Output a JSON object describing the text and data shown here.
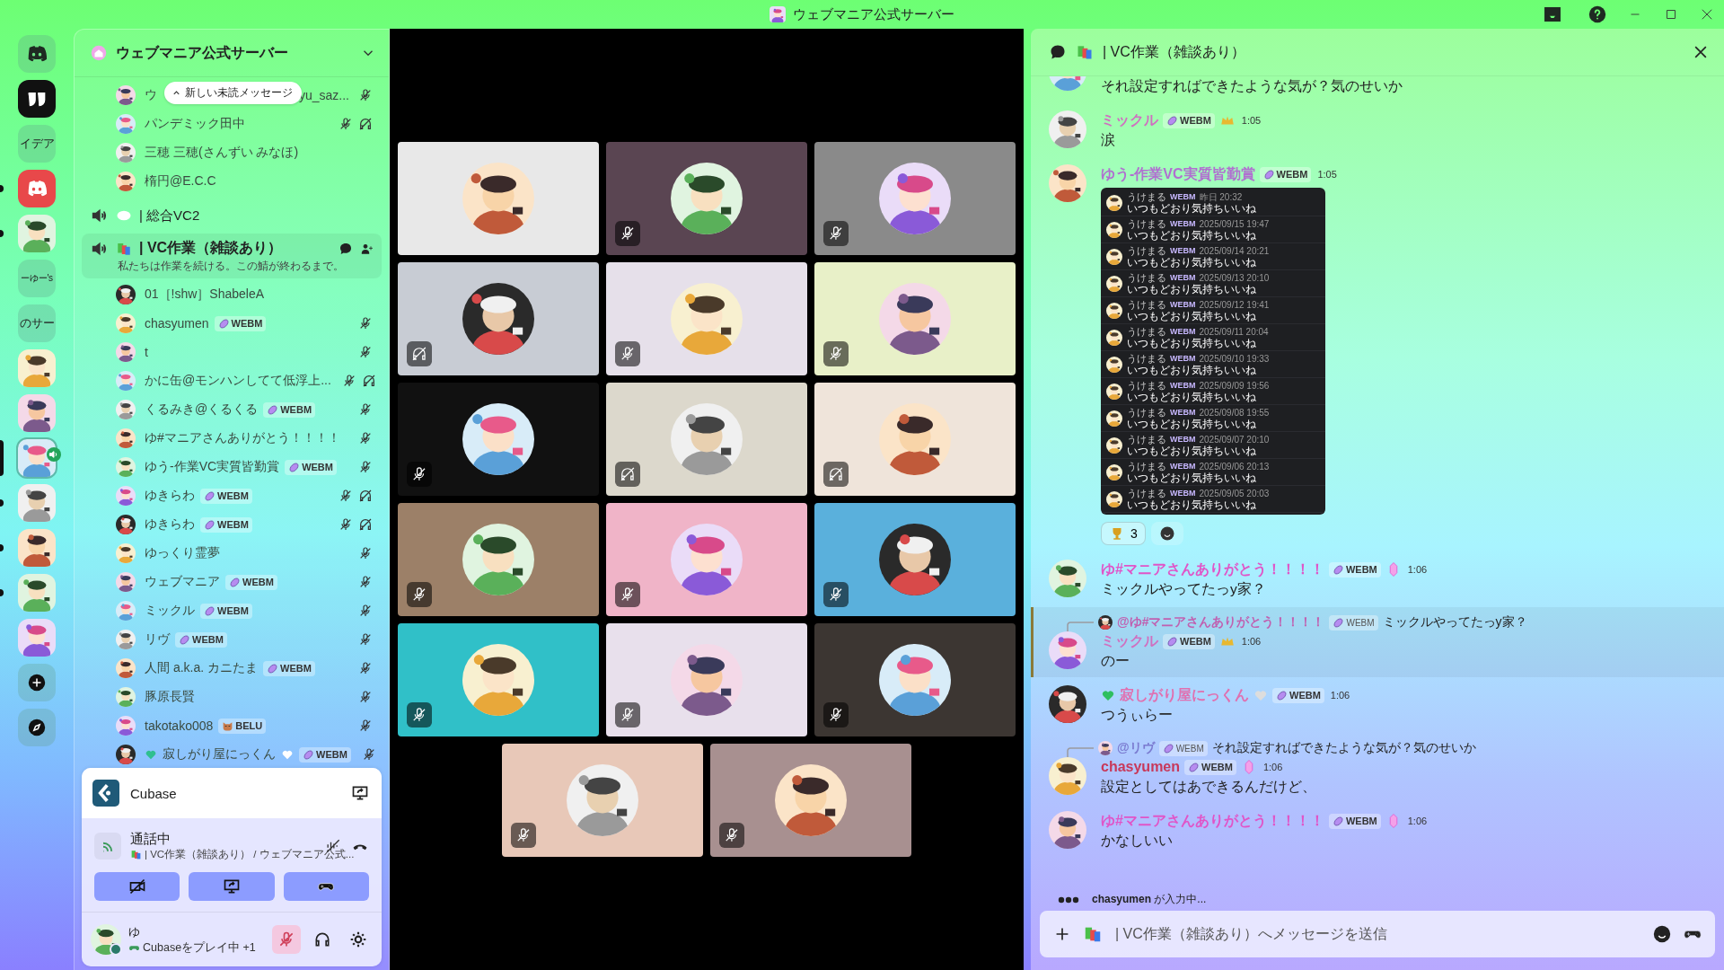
{
  "window": {
    "title": "ウェブマニア公式サーバー"
  },
  "servers": [
    {
      "kind": "home",
      "unread": false,
      "selected": false,
      "in_voice": false
    },
    {
      "kind": "quote",
      "unread": false,
      "selected": false,
      "in_voice": false
    },
    {
      "kind": "text",
      "label": "イデア",
      "unread": false,
      "selected": false,
      "in_voice": false
    },
    {
      "kind": "logo",
      "unread": true,
      "selected": false,
      "in_voice": false
    },
    {
      "kind": "picture",
      "unread": true,
      "selected": false,
      "in_voice": false
    },
    {
      "kind": "text",
      "label": "ーゆー's",
      "unread": false,
      "selected": false,
      "in_voice": false
    },
    {
      "kind": "text",
      "label": "のサー",
      "unread": false,
      "selected": false,
      "in_voice": false
    },
    {
      "kind": "picture",
      "unread": false,
      "selected": false,
      "in_voice": false
    },
    {
      "kind": "picture",
      "unread": false,
      "selected": false,
      "in_voice": false
    },
    {
      "kind": "picture",
      "unread": false,
      "selected": true,
      "in_voice": true
    },
    {
      "kind": "picture",
      "unread": true,
      "selected": false,
      "in_voice": false
    },
    {
      "kind": "picture",
      "unread": true,
      "selected": false,
      "in_voice": false
    },
    {
      "kind": "picture",
      "unread": true,
      "selected": false,
      "in_voice": false
    },
    {
      "kind": "picture",
      "unread": false,
      "selected": false,
      "in_voice": false
    },
    {
      "kind": "add",
      "unread": false,
      "selected": false,
      "in_voice": false
    },
    {
      "kind": "explore",
      "unread": false,
      "selected": false,
      "in_voice": false
    }
  ],
  "server": {
    "name": "ウェブマニア公式サーバー"
  },
  "tooltip": "新しい未読メッセージ",
  "channels": [
    {
      "members": [
        {
          "name": "ウ",
          "name_tail": "yu_saz...",
          "muted": true,
          "deafened": false,
          "hearts": false
        },
        {
          "name": "パンデミック田中",
          "muted": true,
          "deafened": true,
          "hearts": false
        },
        {
          "name": "三穂 三穂(さんずい みなほ)",
          "muted": false,
          "deafened": false,
          "hearts": false
        },
        {
          "name": "楕円@E.C.C",
          "muted": false,
          "deafened": false,
          "hearts": false
        }
      ]
    },
    {
      "name": "| 総合VC2",
      "selected": false
    },
    {
      "name": "| VC作業（雑談あり）",
      "selected": true,
      "status": "私たちは作業を続ける。この鯖が終わるまで。",
      "members": [
        {
          "name": "01［!shw］ShabeleA",
          "muted": false,
          "deafened": false,
          "hearts": false
        },
        {
          "name": "chasyumen",
          "badge": {
            "label": "WEBM",
            "kind": "leaf"
          },
          "muted": true,
          "deafened": false,
          "hearts": false
        },
        {
          "name": "t",
          "muted": true,
          "deafened": false,
          "hearts": false
        },
        {
          "name": "かに缶@モンハンしてて低浮上...",
          "muted": true,
          "deafened": true,
          "hearts": false
        },
        {
          "name": "くるみき@くるくる",
          "badge": {
            "label": "WEBM",
            "kind": "leaf"
          },
          "muted": true,
          "deafened": false,
          "hearts": false
        },
        {
          "name": "ゆ#マニアさんありがとう！！！！",
          "muted": true,
          "deafened": false,
          "hearts": false
        },
        {
          "name": "ゆう-作業VC実質皆勤賞",
          "badge": {
            "label": "WEBM",
            "kind": "leaf"
          },
          "muted": true,
          "deafened": false,
          "hearts": false
        },
        {
          "name": "ゆきらわ",
          "badge": {
            "label": "WEBM",
            "kind": "leaf"
          },
          "muted": true,
          "deafened": true,
          "hearts": false
        },
        {
          "name": "ゆきらわ",
          "badge": {
            "label": "WEBM",
            "kind": "leaf"
          },
          "muted": true,
          "deafened": true,
          "hearts": false
        },
        {
          "name": "ゆっくり霊夢",
          "muted": true,
          "deafened": false,
          "hearts": false
        },
        {
          "name": "ウェブマニア",
          "badge": {
            "label": "WEBM",
            "kind": "leaf"
          },
          "muted": true,
          "deafened": false,
          "hearts": false
        },
        {
          "name": "ミックル",
          "badge": {
            "label": "WEBM",
            "kind": "leaf"
          },
          "muted": true,
          "deafened": false,
          "hearts": false
        },
        {
          "name": "リヴ",
          "badge": {
            "label": "WEBM",
            "kind": "leaf"
          },
          "muted": true,
          "deafened": false,
          "hearts": false
        },
        {
          "name": "人間 a.k.a. カニたま",
          "badge": {
            "label": "WEBM",
            "kind": "leaf"
          },
          "muted": true,
          "deafened": false,
          "hearts": false
        },
        {
          "name": "豚原長賢",
          "muted": true,
          "deafened": false,
          "hearts": false
        },
        {
          "name": "takotako008",
          "badge": {
            "label": "BELU",
            "kind": "cat"
          },
          "muted": true,
          "deafened": false,
          "hearts": false
        },
        {
          "name": "寂しがり屋にっくん",
          "badge": {
            "label": "WEBM",
            "kind": "leaf"
          },
          "muted": true,
          "deafened": false,
          "hearts": true
        }
      ]
    }
  ],
  "voice_panel": {
    "activity": "Cubase",
    "status": "通話中",
    "location": "| VC作業（雑談あり） / ウェブマニア公式...",
    "buttons": [
      {
        "kind": "camera"
      },
      {
        "kind": "share"
      },
      {
        "kind": "activity"
      }
    ],
    "user": {
      "name": "ゆ",
      "activity": "Cubaseをプレイ中 +1",
      "mic_muted": true,
      "deafened": false
    }
  },
  "tiles": [
    {
      "color": "#e8e8e8",
      "muted": false,
      "deafened": false
    },
    {
      "color": "#5a4552",
      "muted": true,
      "deafened": false
    },
    {
      "color": "#8a8a8a",
      "muted": true,
      "deafened": false
    },
    {
      "color": "#c8ccd4",
      "muted": false,
      "deafened": true
    },
    {
      "color": "#e6e0ea",
      "muted": true,
      "deafened": false
    },
    {
      "color": "#e8f0c8",
      "muted": true,
      "deafened": false
    },
    {
      "color": "#111111",
      "muted": true,
      "deafened": false
    },
    {
      "color": "#dcd8cc",
      "muted": false,
      "deafened": true
    },
    {
      "color": "#efe4da",
      "muted": false,
      "deafened": true
    },
    {
      "color": "#9c8068",
      "muted": true,
      "deafened": false
    },
    {
      "color": "#f0b4c8",
      "muted": true,
      "deafened": false
    },
    {
      "color": "#5ab0dc",
      "muted": true,
      "deafened": false
    },
    {
      "color": "#30c0c8",
      "muted": true,
      "deafened": false
    },
    {
      "color": "#e8e0ec",
      "muted": true,
      "deafened": false
    },
    {
      "color": "#3c3632",
      "muted": true,
      "deafened": false
    },
    {
      "color": "#e8c8b8",
      "muted": true,
      "deafened": false
    },
    {
      "color": "#a89090",
      "muted": true,
      "deafened": false
    }
  ],
  "thread": {
    "title": "| VC作業（雑談あり）"
  },
  "messages": [
    {
      "text": "それ設定すればできたような気が？気のせいか",
      "highlighted": false
    },
    {
      "author": "ミックル",
      "color": "#d070c0",
      "hearts": false,
      "badge": "WEBM",
      "flair": {
        "kind": "crown"
      },
      "time": "1:05",
      "text": "涙",
      "highlighted": false
    },
    {
      "author": "ゆう-作業VC実質皆勤賞",
      "color": "#b070d0",
      "hearts": false,
      "badge": "WEBM",
      "time": "1:05",
      "highlighted": false,
      "attachment": [
        {
          "name": "うけまる",
          "badge": "WEBM",
          "date": "昨日 20:32",
          "text": "いつもどおり気持ちいいね"
        },
        {
          "name": "うけまる",
          "badge": "WEBM",
          "date": "2025/09/15 19:47",
          "text": "いつもどおり気持ちいいね"
        },
        {
          "name": "うけまる",
          "badge": "WEBM",
          "date": "2025/09/14 20:21",
          "text": "いつもどおり気持ちいいね"
        },
        {
          "name": "うけまる",
          "badge": "WEBM",
          "date": "2025/09/13 20:10",
          "text": "いつもどおり気持ちいいね"
        },
        {
          "name": "うけまる",
          "badge": "WEBM",
          "date": "2025/09/12 19:41",
          "text": "いつもどおり気持ちいいね"
        },
        {
          "name": "うけまる",
          "badge": "WEBM",
          "date": "2025/09/11 20:04",
          "text": "いつもどおり気持ちいいね"
        },
        {
          "name": "うけまる",
          "badge": "WEBM",
          "date": "2025/09/10 19:33",
          "text": "いつもどおり気持ちいいね"
        },
        {
          "name": "うけまる",
          "badge": "WEBM",
          "date": "2025/09/09 19:56",
          "text": "いつもどおり気持ちいいね"
        },
        {
          "name": "うけまる",
          "badge": "WEBM",
          "date": "2025/09/08 19:55",
          "text": "いつもどおり気持ちいいね"
        },
        {
          "name": "うけまる",
          "badge": "WEBM",
          "date": "2025/09/07 20:10",
          "text": "いつもどおり気持ちいいね"
        },
        {
          "name": "うけまる",
          "badge": "WEBM",
          "date": "2025/09/06 20:13",
          "text": "いつもどおり気持ちいいね"
        },
        {
          "name": "うけまる",
          "badge": "WEBM",
          "date": "2025/09/05 20:03",
          "text": "いつもどおり気持ちいいね"
        }
      ],
      "reactions": [
        {
          "count": "3"
        }
      ]
    },
    {
      "author": "ゆ#マニアさんありがとう！！！！",
      "color": "#e055c8",
      "hearts": false,
      "badge": "WEBM",
      "flair": {
        "kind": "gem"
      },
      "time": "1:06",
      "text": "ミックルやってたっy家？",
      "highlighted": false
    },
    {
      "reply": {
        "author": "@ゆ#マニアさんありがとう！！！！",
        "color": "#c060b0",
        "badge": "WEBM",
        "text": "ミックルやってたっy家？"
      },
      "author": "ミックル",
      "color": "#d070c0",
      "hearts": false,
      "badge": "WEBM",
      "flair": {
        "kind": "crown"
      },
      "time": "1:06",
      "text": "のー",
      "highlighted": true
    },
    {
      "author": "寂しがり屋にっくん",
      "color": "#e070b0",
      "hearts": true,
      "badge": "WEBM",
      "time": "1:06",
      "text": "つうぃらー",
      "highlighted": false
    },
    {
      "reply": {
        "author": "@リヴ",
        "color": "#7a7ad0",
        "badge": "WEBM",
        "text": "それ設定すればできたような気が？気のせいか"
      },
      "author": "chasyumen",
      "color": "#c8385a",
      "hearts": false,
      "badge": "WEBM",
      "flair": {
        "kind": "gem"
      },
      "time": "1:06",
      "text": "設定としてはあできるんだけど、",
      "highlighted": false
    },
    {
      "author": "ゆ#マニアさんありがとう！！！！",
      "color": "#e055c8",
      "hearts": false,
      "badge": "WEBM",
      "flair": {
        "kind": "gem"
      },
      "time": "1:06",
      "text": "かなしいい",
      "highlighted": false
    }
  ],
  "typing": "**chasyumen** が入力中...",
  "composer": {
    "placeholder": "| VC作業（雑談あり）へメッセージを送信"
  }
}
